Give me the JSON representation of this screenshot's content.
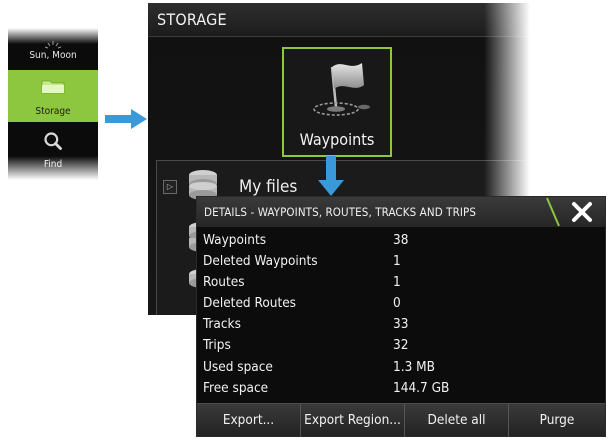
{
  "side_menu": {
    "items": [
      {
        "label": "Sun, Moon",
        "icon": "sun-moon-icon",
        "selected": false
      },
      {
        "label": "Storage",
        "icon": "folder-icon",
        "selected": true
      },
      {
        "label": "Find",
        "icon": "magnifier-icon",
        "selected": false
      }
    ]
  },
  "storage": {
    "title": "STORAGE",
    "tile_label": "Waypoints",
    "tile_icon": "waypoint-flag-icon",
    "files_label": "My files"
  },
  "details": {
    "title": "DETAILS - WAYPOINTS, ROUTES, TRACKS AND TRIPS",
    "close_icon": "close-icon",
    "rows": [
      {
        "label": "Waypoints",
        "value": "38"
      },
      {
        "label": "Deleted Waypoints",
        "value": "1"
      },
      {
        "label": "Routes",
        "value": "1"
      },
      {
        "label": "Deleted Routes",
        "value": "0"
      },
      {
        "label": "Tracks",
        "value": "33"
      },
      {
        "label": "Trips",
        "value": "32"
      },
      {
        "label": "Used space",
        "value": "1.3 MB"
      },
      {
        "label": "Free space",
        "value": "144.7 GB"
      }
    ],
    "buttons": [
      {
        "label": "Export..."
      },
      {
        "label": "Export Region..."
      },
      {
        "label": "Delete all"
      },
      {
        "label": "Purge"
      }
    ]
  },
  "colors": {
    "accent": "#8dc63f",
    "arrow": "#3a9ad9",
    "panel_bg": "#141414"
  }
}
